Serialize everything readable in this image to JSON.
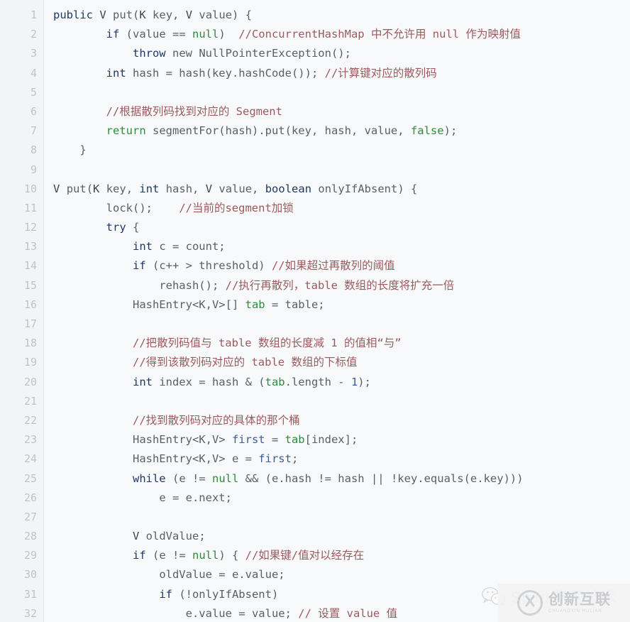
{
  "editor": {
    "language": "java",
    "background_color": "#f8f9fa",
    "gutter_color": "#f2f4f5",
    "line_number_color": "#bfc4c8",
    "first_line_number": 1,
    "last_line_number": 32,
    "line_numbers": [
      1,
      2,
      3,
      4,
      5,
      6,
      7,
      8,
      9,
      10,
      11,
      12,
      13,
      14,
      15,
      16,
      17,
      18,
      19,
      20,
      21,
      22,
      23,
      24,
      25,
      26,
      27,
      28,
      29,
      30,
      31,
      32
    ],
    "colors": {
      "keyword": "#1f3864",
      "plain": "#5a6068",
      "literal_green": "#2e8b3d",
      "comment": "#9c5a5e",
      "number": "#3a5f9e",
      "identifier_blue": "#3f5c94"
    },
    "lines": [
      {
        "n": 1,
        "tokens": [
          {
            "t": "public",
            "c": "kw"
          },
          {
            "t": " ",
            "c": "plain"
          },
          {
            "t": "V",
            "c": "dark"
          },
          {
            "t": " ",
            "c": "plain"
          },
          {
            "t": "put",
            "c": "plain"
          },
          {
            "t": "(",
            "c": "plain"
          },
          {
            "t": "K",
            "c": "dark"
          },
          {
            "t": " key, ",
            "c": "plain"
          },
          {
            "t": "V",
            "c": "dark"
          },
          {
            "t": " value) {",
            "c": "plain"
          }
        ]
      },
      {
        "n": 2,
        "tokens": [
          {
            "t": "        ",
            "c": "plain"
          },
          {
            "t": "if",
            "c": "kw"
          },
          {
            "t": " (value == ",
            "c": "plain"
          },
          {
            "t": "null",
            "c": "green"
          },
          {
            "t": ")  ",
            "c": "plain"
          },
          {
            "t": "//ConcurrentHashMap 中不允许用 null 作为映射值",
            "c": "cmt"
          }
        ]
      },
      {
        "n": 3,
        "tokens": [
          {
            "t": "            ",
            "c": "plain"
          },
          {
            "t": "throw",
            "c": "kw"
          },
          {
            "t": " ",
            "c": "plain"
          },
          {
            "t": "new",
            "c": "plain"
          },
          {
            "t": " NullPointerException();",
            "c": "plain"
          }
        ]
      },
      {
        "n": 4,
        "tokens": [
          {
            "t": "        ",
            "c": "plain"
          },
          {
            "t": "int",
            "c": "kw"
          },
          {
            "t": " hash = hash(key.hashCode()); ",
            "c": "plain"
          },
          {
            "t": "//计算键对应的散列码",
            "c": "cmt"
          }
        ]
      },
      {
        "n": 5,
        "tokens": []
      },
      {
        "n": 6,
        "tokens": [
          {
            "t": "        ",
            "c": "plain"
          },
          {
            "t": "//根据散列码找到对应的 Segment",
            "c": "cmt"
          }
        ]
      },
      {
        "n": 7,
        "tokens": [
          {
            "t": "        ",
            "c": "plain"
          },
          {
            "t": "return",
            "c": "green"
          },
          {
            "t": " segmentFor(hash).put(key, hash, value, ",
            "c": "plain"
          },
          {
            "t": "false",
            "c": "green"
          },
          {
            "t": ");",
            "c": "plain"
          }
        ]
      },
      {
        "n": 8,
        "tokens": [
          {
            "t": "    }",
            "c": "plain"
          }
        ]
      },
      {
        "n": 9,
        "tokens": []
      },
      {
        "n": 10,
        "tokens": [
          {
            "t": "V",
            "c": "dark"
          },
          {
            "t": " ",
            "c": "plain"
          },
          {
            "t": "put",
            "c": "plain"
          },
          {
            "t": "(",
            "c": "plain"
          },
          {
            "t": "K",
            "c": "dark"
          },
          {
            "t": " key, ",
            "c": "plain"
          },
          {
            "t": "int",
            "c": "kw"
          },
          {
            "t": " hash, ",
            "c": "plain"
          },
          {
            "t": "V",
            "c": "dark"
          },
          {
            "t": " value, ",
            "c": "plain"
          },
          {
            "t": "boolean",
            "c": "kw"
          },
          {
            "t": " onlyIfAbsent) {",
            "c": "plain"
          }
        ]
      },
      {
        "n": 11,
        "tokens": [
          {
            "t": "        ",
            "c": "plain"
          },
          {
            "t": "lock();",
            "c": "plain"
          },
          {
            "t": "    ",
            "c": "plain"
          },
          {
            "t": "//当前的segment加锁",
            "c": "cmt"
          }
        ]
      },
      {
        "n": 12,
        "tokens": [
          {
            "t": "        ",
            "c": "plain"
          },
          {
            "t": "try",
            "c": "kw"
          },
          {
            "t": " {",
            "c": "plain"
          }
        ]
      },
      {
        "n": 13,
        "tokens": [
          {
            "t": "            ",
            "c": "plain"
          },
          {
            "t": "int",
            "c": "kw"
          },
          {
            "t": " c = count;",
            "c": "plain"
          }
        ]
      },
      {
        "n": 14,
        "tokens": [
          {
            "t": "            ",
            "c": "plain"
          },
          {
            "t": "if",
            "c": "kw"
          },
          {
            "t": " (c++ > threshold) ",
            "c": "plain"
          },
          {
            "t": "//如果超过再散列的阈值",
            "c": "cmt"
          }
        ]
      },
      {
        "n": 15,
        "tokens": [
          {
            "t": "                ",
            "c": "plain"
          },
          {
            "t": "rehash(); ",
            "c": "plain"
          },
          {
            "t": "//执行再散列，table 数组的长度将扩充一倍",
            "c": "cmt"
          }
        ]
      },
      {
        "n": 16,
        "tokens": [
          {
            "t": "            ",
            "c": "plain"
          },
          {
            "t": "HashEntry<K,V>[] ",
            "c": "plain"
          },
          {
            "t": "tab",
            "c": "green"
          },
          {
            "t": " = table;",
            "c": "plain"
          }
        ]
      },
      {
        "n": 17,
        "tokens": []
      },
      {
        "n": 18,
        "tokens": [
          {
            "t": "            ",
            "c": "plain"
          },
          {
            "t": "//把散列码值与 table 数组的长度减 1 的值相“与”",
            "c": "cmt"
          }
        ]
      },
      {
        "n": 19,
        "tokens": [
          {
            "t": "            ",
            "c": "plain"
          },
          {
            "t": "//得到该散列码对应的 table 数组的下标值",
            "c": "cmt"
          }
        ]
      },
      {
        "n": 20,
        "tokens": [
          {
            "t": "            ",
            "c": "plain"
          },
          {
            "t": "int",
            "c": "kw"
          },
          {
            "t": " index = hash & (",
            "c": "plain"
          },
          {
            "t": "tab",
            "c": "green"
          },
          {
            "t": ".length - ",
            "c": "plain"
          },
          {
            "t": "1",
            "c": "num"
          },
          {
            "t": ");",
            "c": "plain"
          }
        ]
      },
      {
        "n": 21,
        "tokens": []
      },
      {
        "n": 22,
        "tokens": [
          {
            "t": "            ",
            "c": "plain"
          },
          {
            "t": "//找到散列码对应的具体的那个桶",
            "c": "cmt"
          }
        ]
      },
      {
        "n": 23,
        "tokens": [
          {
            "t": "            ",
            "c": "plain"
          },
          {
            "t": "HashEntry<K,V> ",
            "c": "plain"
          },
          {
            "t": "first",
            "c": "blue"
          },
          {
            "t": " = ",
            "c": "plain"
          },
          {
            "t": "tab",
            "c": "green"
          },
          {
            "t": "[index];",
            "c": "plain"
          }
        ]
      },
      {
        "n": 24,
        "tokens": [
          {
            "t": "            ",
            "c": "plain"
          },
          {
            "t": "HashEntry<K,V> e = ",
            "c": "plain"
          },
          {
            "t": "first",
            "c": "blue"
          },
          {
            "t": ";",
            "c": "plain"
          }
        ]
      },
      {
        "n": 25,
        "tokens": [
          {
            "t": "            ",
            "c": "plain"
          },
          {
            "t": "while",
            "c": "kw"
          },
          {
            "t": " (e != ",
            "c": "plain"
          },
          {
            "t": "null",
            "c": "green"
          },
          {
            "t": " && (e.hash != hash || !key.equals(e.key)))",
            "c": "plain"
          }
        ]
      },
      {
        "n": 26,
        "tokens": [
          {
            "t": "                ",
            "c": "plain"
          },
          {
            "t": "e = e.next;",
            "c": "plain"
          }
        ]
      },
      {
        "n": 27,
        "tokens": []
      },
      {
        "n": 28,
        "tokens": [
          {
            "t": "            ",
            "c": "plain"
          },
          {
            "t": "V",
            "c": "dark"
          },
          {
            "t": " oldValue;",
            "c": "plain"
          }
        ]
      },
      {
        "n": 29,
        "tokens": [
          {
            "t": "            ",
            "c": "plain"
          },
          {
            "t": "if",
            "c": "kw"
          },
          {
            "t": " (e != ",
            "c": "plain"
          },
          {
            "t": "null",
            "c": "green"
          },
          {
            "t": ") { ",
            "c": "plain"
          },
          {
            "t": "//如果键/值对以经存在",
            "c": "cmt"
          }
        ]
      },
      {
        "n": 30,
        "tokens": [
          {
            "t": "                ",
            "c": "plain"
          },
          {
            "t": "oldValue = e.value;",
            "c": "plain"
          }
        ]
      },
      {
        "n": 31,
        "tokens": [
          {
            "t": "                ",
            "c": "plain"
          },
          {
            "t": "if",
            "c": "kw"
          },
          {
            "t": " (!onlyIfAbsent)",
            "c": "plain"
          }
        ]
      },
      {
        "n": 32,
        "tokens": [
          {
            "t": "                    ",
            "c": "plain"
          },
          {
            "t": "e.value = value; ",
            "c": "plain"
          },
          {
            "t": "// 设置 value 值",
            "c": "cmt"
          }
        ]
      }
    ]
  },
  "watermarks": {
    "wechat": {
      "icon": "wechat-icon",
      "text": "Spark学习技术"
    },
    "brand": {
      "icon": "cni-logo-icon",
      "name_cn": "创新互联",
      "name_en": "CHUANGXIN HULIAN"
    }
  }
}
